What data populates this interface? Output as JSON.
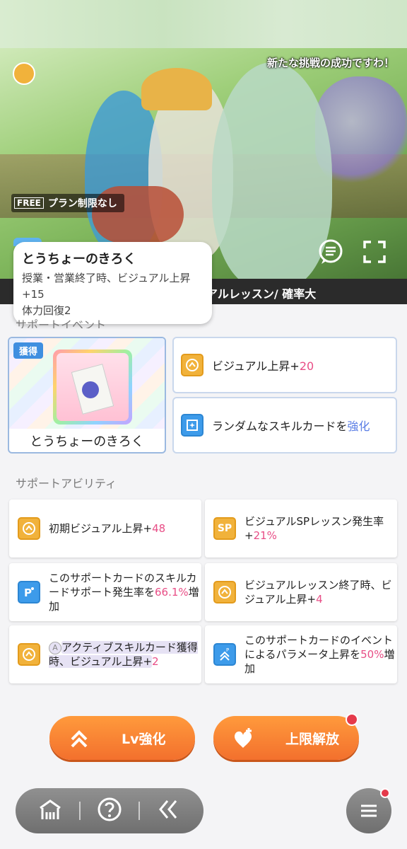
{
  "banner": {
    "quote": "新たな挑戦の成功ですわ！",
    "free_badge": "FREE",
    "free_text": "プラン制限なし",
    "lesson_text": "アルレッスン/ 確率大"
  },
  "tooltip": {
    "title": "とうちょーのきろく",
    "line1": "授業・営業終了時、ビジュアル上昇",
    "line2": "+15",
    "line3": "体力回復2"
  },
  "support_event": {
    "section_label": "サポートイベント",
    "get_badge": "獲得",
    "item_name": "とうちょーのきろく",
    "effects": [
      {
        "text": "ビジュアル上昇+",
        "value": "20",
        "icon": "visual-up-icon"
      },
      {
        "text": "ランダムなスキルカードを",
        "value": "強化",
        "icon": "skill-card-enhance-icon"
      }
    ]
  },
  "abilities": {
    "section_label": "サポートアビリティ",
    "items": [
      {
        "icon": "visual-up-icon",
        "parts": [
          "初期ビジュアル上昇+",
          "48"
        ]
      },
      {
        "icon": "sp-lesson-icon",
        "icon_text": "SP",
        "parts": [
          "ビジュアルSPレッスン発生率+",
          "21%"
        ]
      },
      {
        "icon": "skill-card-support-icon",
        "parts": [
          "このサポートカードのスキルカードサポート発生率を",
          "66.1%",
          "増加"
        ]
      },
      {
        "icon": "visual-up-icon",
        "parts": [
          "ビジュアルレッスン終了時、ビジュアル上昇+",
          "4"
        ]
      },
      {
        "icon": "visual-up-icon",
        "parts": [
          "アクティブスキルカード獲得時、ビジュアル上昇+",
          "2"
        ],
        "prefix_icon": "active-a-icon"
      },
      {
        "icon": "parameter-up-icon",
        "parts": [
          "このサポートカードのイベントによるパラメータ上昇を",
          "50%",
          "増加"
        ]
      }
    ]
  },
  "buttons": {
    "level_up": "Lv強化",
    "limit_break": "上限解放"
  },
  "colors": {
    "accent_orange": "#f3702d",
    "value_pink": "#e84e86",
    "value_blue": "#5b7ee5",
    "badge_blue": "#3f8fe0",
    "notification_red": "#e53a4b"
  }
}
